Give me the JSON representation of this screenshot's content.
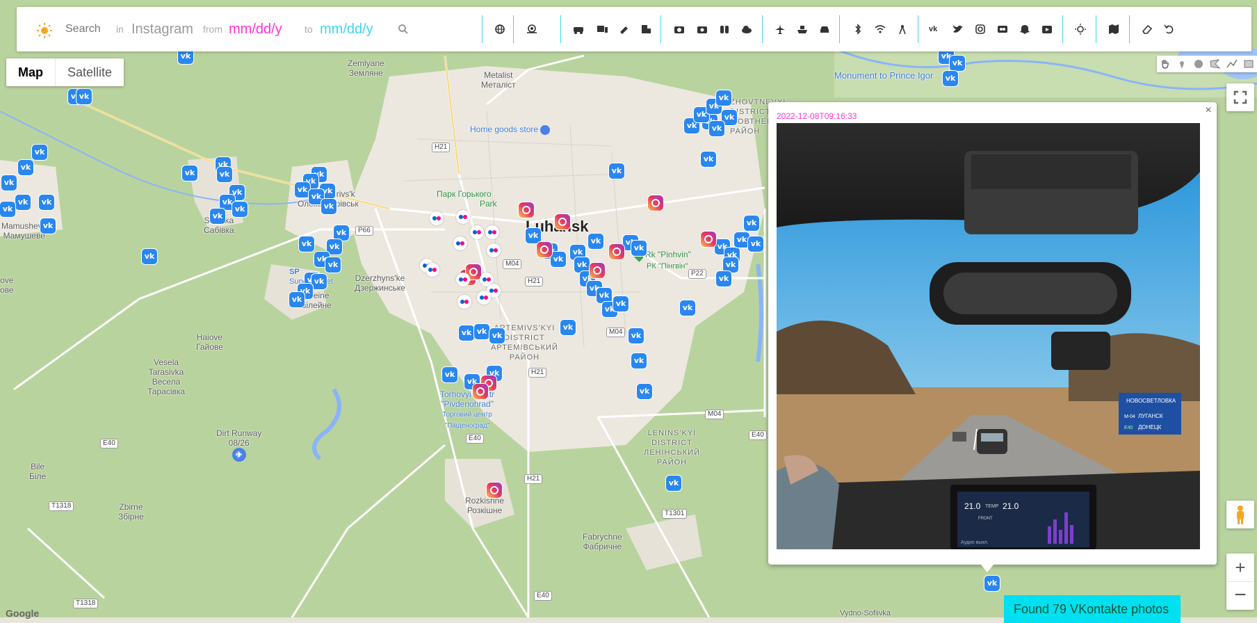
{
  "toolbar": {
    "search_label": "Search",
    "in_label": "in",
    "source": "Instagram",
    "from_label": "from",
    "from_date_placeholder": "mm/dd/y",
    "to_label": "to",
    "to_date_placeholder": "mm/dd/y",
    "accent_pink": "#ff2fd6",
    "accent_cyan": "#3fd6e6",
    "icons": [
      "globe-icon",
      "snail-icon",
      "cars-icon",
      "devices-icon",
      "satellite-dish-icon",
      "building-icon",
      "camera-icon",
      "camera-alt-icon",
      "binoculars-icon",
      "cloud-icon",
      "plane-icon",
      "ship-icon",
      "car-icon",
      "bluetooth-icon",
      "wifi-icon",
      "cell-tower-icon",
      "vk-icon",
      "twitter-icon",
      "instagram-icon",
      "flickr-icon",
      "snapchat-icon",
      "youtube-icon",
      "sun-settings-icon",
      "map-icon",
      "eraser-icon",
      "undo-icon"
    ]
  },
  "map_type": {
    "map_label": "Map",
    "satellite_label": "Satellite",
    "selected": "Map"
  },
  "places": {
    "zemlyane_en": "Zemlyane",
    "zemlyane_uk": "Землянe",
    "metalist_en": "Metalist",
    "metalist_uk": "Металіст",
    "home_goods": "Home goods store",
    "park": "Парк Горького",
    "park_sub": "Park",
    "luhansk": "Luhansk",
    "oleksandrivsk": "Oleksandrivs'k",
    "oleksandrivsk_uk": "Олександрівськ",
    "sabivka_en": "Sabivka",
    "sabivka_uk": "Сабівка",
    "mamusheve_en": "Mamusheve",
    "mamusheve_uk": "Мамушеве",
    "dzerzhynske_en": "Dzerzhyns'ke",
    "dzerzhynske_uk": "Дзержинське",
    "yuvileine_en": "Yuvileine",
    "yuvileine_uk": "Ювілейне",
    "haiove_en": "Haiove",
    "haiove_uk": "Гайове",
    "vesela_en": "Vesela",
    "vesela_en2": "Tarasivka",
    "vesela_uk": "Весела",
    "vesela_uk2": "Тарасівка",
    "artemivskyi_1": "ARTEMIVS'KYI",
    "artemivskyi_2": "DISTRICT",
    "artemivskyi_uk1": "АРТЕМІВСЬКИЙ",
    "artemivskyi_uk2": "РАЙОН",
    "torhovyi_1": "Torhovyi tsentr",
    "torhovyi_2": "\"Pivdenohrad\"",
    "torhovyi_uk1": "Торговий центр",
    "torhovyi_uk2": "\"Південоград\"",
    "dirt_runway": "Dirt Runway",
    "dirt_runway_2": "08/26",
    "bile_en": "Bile",
    "bile_uk": "Біле",
    "zbirne_en": "Zbirne",
    "zbirne_uk": "Збірне",
    "rozkishne_en": "Rozkishne",
    "rozkishne_uk": "Розкішне",
    "leninskyi_1": "LENINS'KYI",
    "leninskyi_2": "DISTRICT",
    "leninskyi_uk1": "ЛЕНІНСЬКИЙ",
    "leninskyi_uk2": "РАЙОН",
    "fabrychne_en": "Fabrychne",
    "fabrychne_uk": "Фабричне",
    "zhovtnevyi_1": "ZHOVTNEVYI",
    "zhovtnevyi_2": "DISTRICT",
    "zhovtnevyi_uk": "ЖОВТНЕВИЙ",
    "zhovtnevyi_uk2": "РАЙОН",
    "pinhvin": "Rk \"Pinhvin\"",
    "pinhvin_uk": "РК \"Пінгвін\"",
    "monument": "Monument to Prince Igor",
    "sp_label": "SP",
    "supermarket": "Supermarket",
    "vydno": "Vydno-Sofiivka",
    "ove": "ove",
    "ove_uk": "ове"
  },
  "roads": [
    "H21",
    "P66",
    "M04",
    "H21",
    "P22",
    "M04",
    "H21",
    "E40",
    "M04",
    "E40",
    "H21",
    "T1301",
    "E40",
    "T1318",
    "T1318",
    "E40",
    "E40",
    "M04"
  ],
  "popup": {
    "timestamp": "2022-12-08T09:16:33",
    "close": "×",
    "sign_top": "НОВОСВЕТЛОВКА",
    "sign_mid": "ЛУГАНСК",
    "sign_bot": "ДОНЕЦК",
    "sign_m": "M-04",
    "sign_e": "E40",
    "screen_temp_1": "21.0",
    "screen_temp_2": "21.0",
    "screen_temp_lbl": "TEMP",
    "screen_front": "FRONT",
    "screen_audio": "Аудио выкл."
  },
  "status": {
    "found": "Found 79 VKontakte photos"
  },
  "google": "Google"
}
